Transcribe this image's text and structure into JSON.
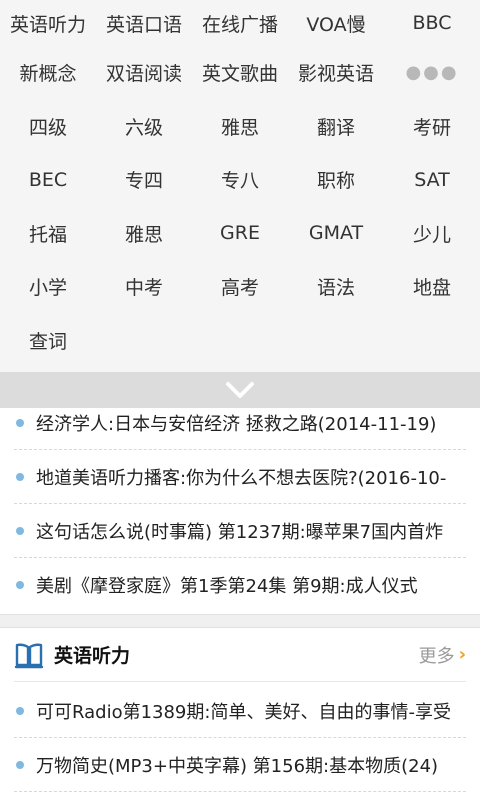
{
  "categories": [
    [
      "英语听力",
      "英语口语",
      "在线广播",
      "VOA慢",
      "BBC"
    ],
    [
      "新概念",
      "双语阅读",
      "英文歌曲",
      "影视英语"
    ],
    [
      "四级",
      "六级",
      "雅思",
      "翻译",
      "考研"
    ],
    [
      "BEC",
      "专四",
      "专八",
      "职称",
      "SAT"
    ],
    [
      "托福",
      "雅思",
      "GRE",
      "GMAT",
      "少儿"
    ],
    [
      "小学",
      "中考",
      "高考",
      "语法",
      "地盘"
    ],
    [
      "查词"
    ]
  ],
  "more_dots": "●●●",
  "news": [
    "经济学人:日本与安倍经济 拯救之路(2014-11-19)",
    "地道美语听力播客:你为什么不想去医院?(2016-10-",
    "这句话怎么说(时事篇) 第1237期:曝苹果7国内首炸",
    "美剧《摩登家庭》第1季第24集 第9期:成人仪式"
  ],
  "section": {
    "title": "英语听力",
    "more": "更多",
    "more_arrow": "›",
    "items": [
      "可可Radio第1389期:简单、美好、自由的事情-享受",
      "万物简史(MP3+中英字幕) 第156期:基本物质(24)"
    ]
  },
  "colors": {
    "accent_blue": "#2a6fb0",
    "dot_blue": "#7fb8e0",
    "more_orange": "#f0a020"
  }
}
